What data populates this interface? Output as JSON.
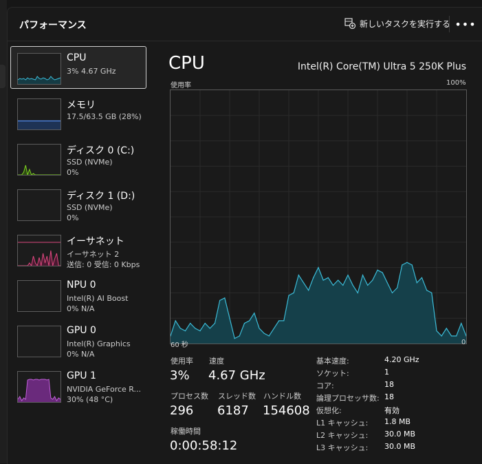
{
  "header": {
    "title": "パフォーマンス",
    "new_task_label": "新しいタスクを実行する",
    "more_label": "•••"
  },
  "sidebar": [
    {
      "id": "cpu",
      "name": "CPU",
      "sub1": "3%  4.67 GHz",
      "sub2": "",
      "color": "#3cbcd8",
      "fill": "#153b44",
      "selected": true
    },
    {
      "id": "memory",
      "name": "メモリ",
      "sub1": "17.5/63.5 GB (28%)",
      "sub2": "",
      "color": "#4a7fd6",
      "fill": "#1e3355",
      "level": 0.28
    },
    {
      "id": "disk0",
      "name": "ディスク 0 (C:)",
      "sub1": "SSD (NVMe)",
      "sub2": "0%",
      "color": "#7ed321",
      "fill": "#2e4a12"
    },
    {
      "id": "disk1",
      "name": "ディスク 1 (D:)",
      "sub1": "SSD (NVMe)",
      "sub2": "0%",
      "color": "#7ed321",
      "fill": "#2e4a12"
    },
    {
      "id": "ethernet",
      "name": "イーサネット",
      "sub1": "イーサネット 2",
      "sub2": "送信: 0 受信: 0 Kbps",
      "color": "#e04880",
      "fill": "#4a1830"
    },
    {
      "id": "npu",
      "name": "NPU 0",
      "sub1": "Intel(R) AI Boost",
      "sub2": "0%  N/A",
      "color": "#3cbcd8",
      "fill": "#153b44"
    },
    {
      "id": "gpu0",
      "name": "GPU 0",
      "sub1": "Intel(R) Graphics",
      "sub2": "0%  N/A",
      "color": "#b048c8",
      "fill": "#3c1a48"
    },
    {
      "id": "gpu1",
      "name": "GPU 1",
      "sub1": "NVIDIA GeForce R...",
      "sub2": "30%  (48 °C)",
      "color": "#c060d8",
      "fill": "#6a2a7c"
    }
  ],
  "main": {
    "title": "CPU",
    "model": "Intel(R) Core(TM) Ultra 5 250K Plus",
    "graph": {
      "y_label": "使用率",
      "y_max_label": "100%",
      "x_left_label": "60 秒",
      "x_right_label": "0",
      "line_color": "#3cbcd8",
      "fill_color": "#15404a",
      "grid_color": "#2b2b2b"
    },
    "stats": {
      "usage_label": "使用率",
      "usage": "3%",
      "speed_label": "速度",
      "speed": "4.67 GHz",
      "processes_label": "プロセス数",
      "processes": "296",
      "threads_label": "スレッド数",
      "threads": "6187",
      "handles_label": "ハンドル数",
      "handles": "154608",
      "uptime_label": "稼働時間",
      "uptime": "0:00:58:12"
    },
    "specs": [
      {
        "label": "基本速度:",
        "value": "4.20 GHz"
      },
      {
        "label": "ソケット:",
        "value": "1"
      },
      {
        "label": "コア:",
        "value": "18"
      },
      {
        "label": "論理プロセッサ数:",
        "value": "18"
      },
      {
        "label": "仮想化:",
        "value": "有効"
      },
      {
        "label": "L1 キャッシュ:",
        "value": "1.8 MB"
      },
      {
        "label": "L2 キャッシュ:",
        "value": "30.0 MB"
      },
      {
        "label": "L3 キャッシュ:",
        "value": "30.0 MB"
      }
    ]
  },
  "chart_data": {
    "type": "area",
    "title": "CPU",
    "ylabel": "使用率",
    "ylim": [
      0,
      100
    ],
    "xlim": [
      60,
      0
    ],
    "x": [
      60,
      59,
      58,
      57,
      56,
      55,
      54,
      53,
      52,
      51,
      50,
      49,
      48,
      47,
      46,
      45,
      44,
      43,
      42,
      41,
      40,
      39,
      38,
      37,
      36,
      35,
      34,
      33,
      32,
      31,
      30,
      29,
      28,
      27,
      26,
      25,
      24,
      23,
      22,
      21,
      20,
      19,
      18,
      17,
      16,
      15,
      14,
      13,
      12,
      11,
      10,
      9,
      8,
      7,
      6,
      5,
      4,
      3,
      2,
      1,
      0
    ],
    "series": [
      {
        "values": [
          3,
          9,
          6,
          5,
          8,
          6,
          5,
          8,
          6,
          8,
          17,
          18,
          10,
          2,
          3,
          8,
          9,
          12,
          6,
          4,
          3,
          6,
          9,
          9,
          19,
          20,
          27,
          24,
          21,
          26,
          30,
          25,
          26,
          23,
          25,
          23,
          27,
          23,
          20,
          27,
          23,
          25,
          29,
          28,
          24,
          20,
          22,
          31,
          32,
          31,
          24,
          26,
          21,
          20,
          5,
          3,
          6,
          3,
          3,
          8,
          3
        ]
      }
    ]
  }
}
